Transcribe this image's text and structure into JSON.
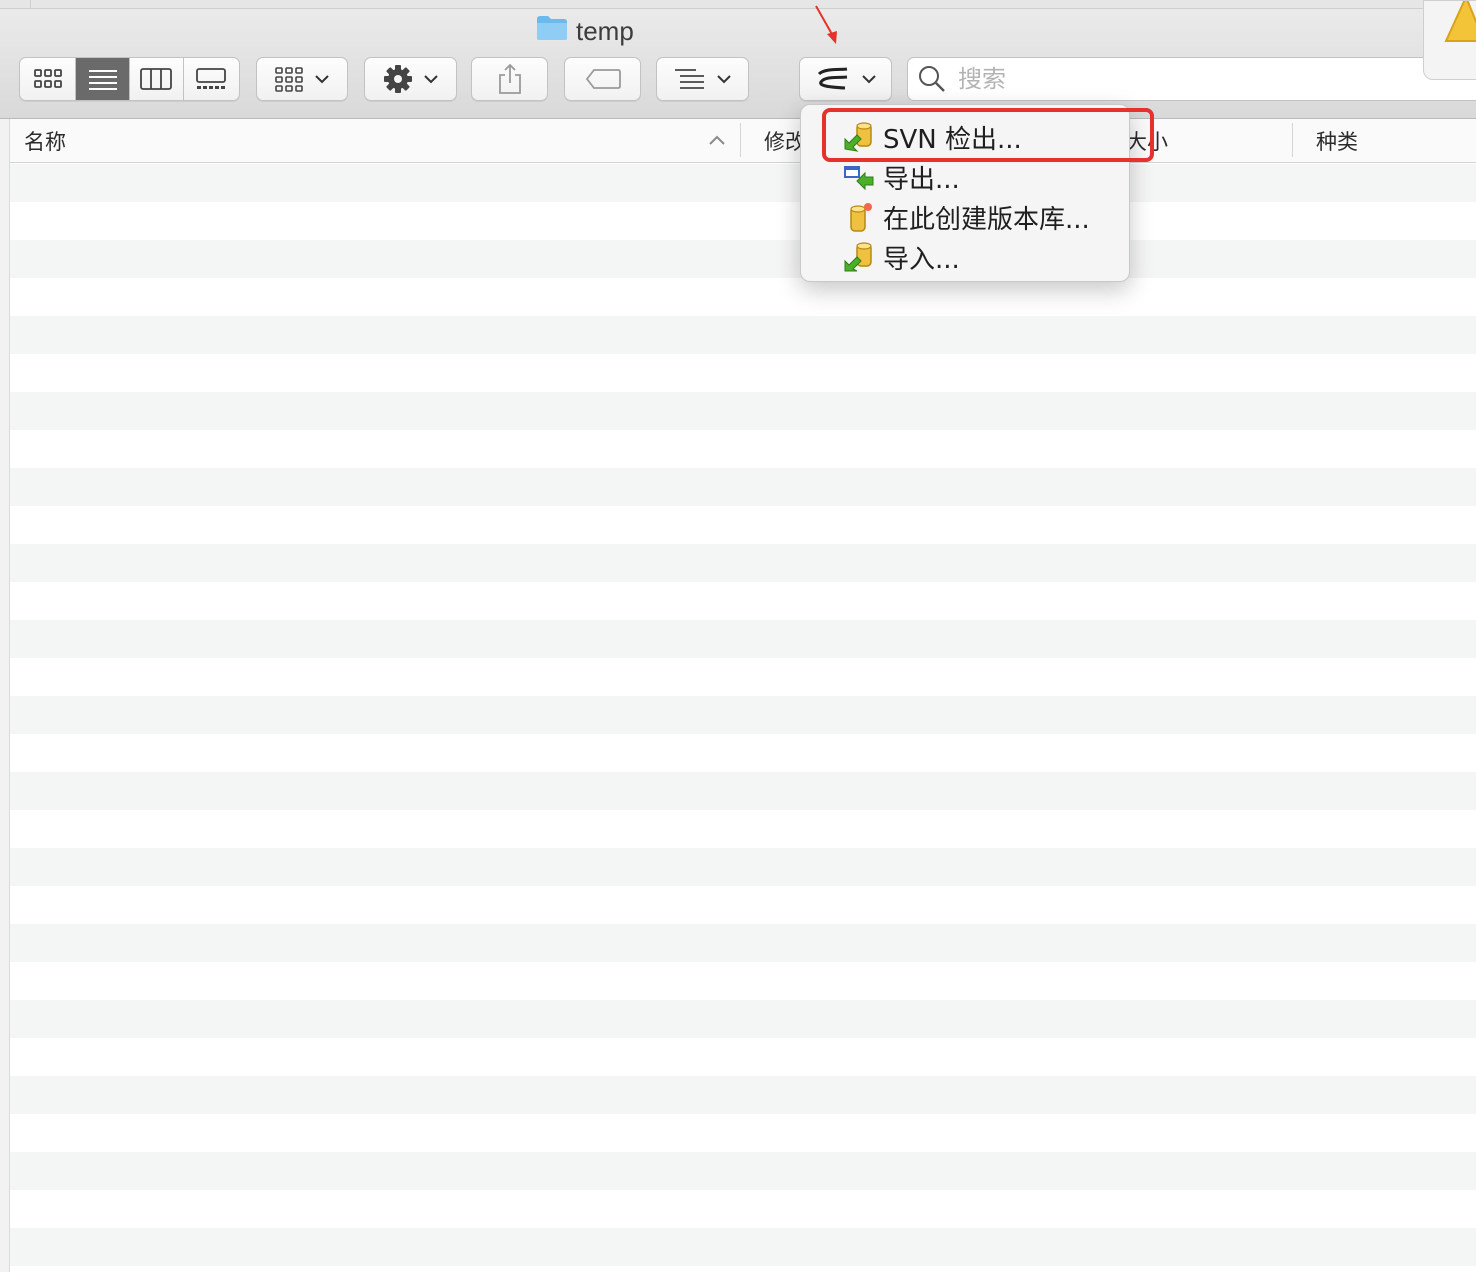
{
  "window": {
    "title": "temp"
  },
  "toolbar": {
    "view_icons": [
      "icon-view-icon",
      "list-view-icon",
      "column-view-icon",
      "gallery-view-icon"
    ],
    "active_view": "list",
    "svn_dropdown_icon": "svn-icon"
  },
  "search": {
    "placeholder": "搜索"
  },
  "columns": {
    "name": "名称",
    "modified": "修改",
    "size": "大小",
    "kind": "种类"
  },
  "svn_menu": {
    "items": [
      {
        "label": "SVN 检出...",
        "icon": "svn-checkout-icon",
        "highlighted": true
      },
      {
        "label": "导出...",
        "icon": "svn-export-icon"
      },
      {
        "label": "在此创建版本库...",
        "icon": "svn-create-repo-icon"
      },
      {
        "label": "导入...",
        "icon": "svn-import-icon"
      }
    ]
  },
  "colors": {
    "highlight_border": "#e6322b",
    "active_segment": "#6a6a6a",
    "folder_blue": "#6cb9ee"
  }
}
